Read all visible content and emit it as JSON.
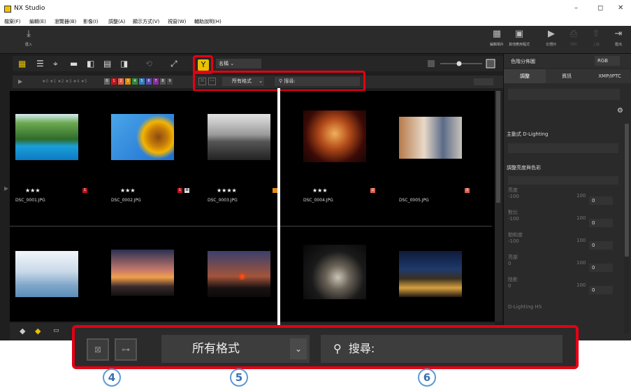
{
  "app": {
    "title": "NX Studio"
  },
  "menu": [
    "檔案(F)",
    "編輯(E)",
    "瀏覽器(B)",
    "影像(I)",
    "調整(A)",
    "顯示方式(V)",
    "視窗(W)",
    "輔助說明(H)"
  ],
  "toolbar": {
    "import": "匯入",
    "labels": [
      "編輯相片",
      "其他應用程式",
      "幻燈片",
      "列印",
      "上載",
      "匯出"
    ]
  },
  "viewbar": {
    "sort": "名稱"
  },
  "filterbar": {
    "ratings": "★0 ★1 ★2 ★3 ★4 ★5",
    "labels": [
      "0",
      "1",
      "2",
      "3",
      "4",
      "5",
      "6",
      "7",
      "8",
      "9"
    ],
    "format": "所有格式",
    "search": "搜尋:"
  },
  "photos": [
    {
      "name": "DSC_0001.JPG",
      "stars": "★★★",
      "label": "1",
      "labelColor": "#c4121a"
    },
    {
      "name": "DSC_0002.JPG",
      "stars": "★★★",
      "label": "1",
      "labelColor": "#c4121a"
    },
    {
      "name": "DSC_0003.JPG",
      "stars": "★★★★",
      "label": "",
      "labelColor": "#e58a1a"
    },
    {
      "name": "DSC_0004.JPG",
      "stars": "★★★",
      "label": "2",
      "labelColor": "#e0604a"
    },
    {
      "name": "DSC_0005.JPG",
      "stars": "",
      "label": "3",
      "labelColor": "#e0604a"
    }
  ],
  "right": {
    "tabs": [
      "調整",
      "資訊",
      "XMP/IPTC"
    ],
    "histogram": "色階分佈圖",
    "mode": "RGB",
    "adl": "主動式 D-Lighting",
    "adjust": "調整亮度與色彩",
    "sliders": [
      {
        "label": "亮度",
        "min": "-100",
        "max": "100",
        "value": "0"
      },
      {
        "label": "對比",
        "min": "-100",
        "max": "100",
        "value": "0"
      },
      {
        "label": "飽和度",
        "min": "-100",
        "max": "100",
        "value": "0"
      },
      {
        "label": "亮部",
        "min": "0",
        "max": "100",
        "value": "0"
      },
      {
        "label": "陰影",
        "min": "0",
        "max": "100",
        "value": "0"
      }
    ],
    "dlhs": "D-Lighting HS"
  },
  "callout": {
    "format": "所有格式",
    "search": "搜尋:",
    "numbers": [
      "4",
      "5",
      "6"
    ]
  }
}
